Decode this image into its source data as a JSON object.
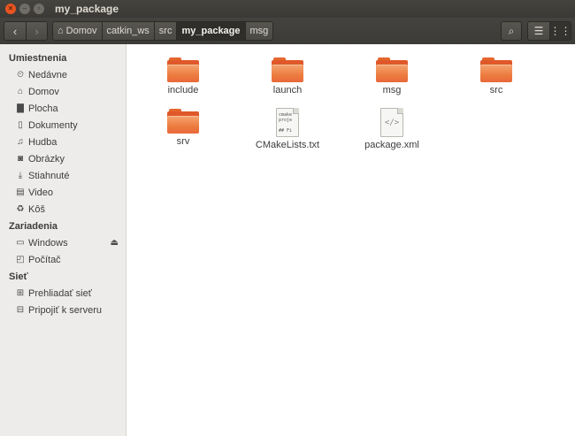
{
  "window": {
    "title": "my_package",
    "close_glyph": "✕",
    "min_glyph": "–",
    "max_glyph": "▫"
  },
  "toolbar": {
    "back_glyph": "‹",
    "forward_glyph": "›",
    "breadcrumbs": [
      "Domov",
      "catkin_ws",
      "src",
      "my_package",
      "msg"
    ],
    "search_glyph": "⌕",
    "list_view_glyph": "☰",
    "grid_view_glyph": "⋮⋮"
  },
  "sidebar": {
    "sections": [
      {
        "title": "Umiestnenia",
        "items": [
          {
            "label": "Nedávne",
            "icon": "clock-icon",
            "glyph": "⏲"
          },
          {
            "label": "Domov",
            "icon": "home-icon",
            "glyph": "⌂"
          },
          {
            "label": "Plocha",
            "icon": "desktop-folder-icon",
            "glyph": "▇"
          },
          {
            "label": "Dokumenty",
            "icon": "document-icon",
            "glyph": "▯"
          },
          {
            "label": "Hudba",
            "icon": "music-icon",
            "glyph": "♫"
          },
          {
            "label": "Obrázky",
            "icon": "camera-icon",
            "glyph": "◙"
          },
          {
            "label": "Stiahnuté",
            "icon": "download-icon",
            "glyph": "⤓"
          },
          {
            "label": "Video",
            "icon": "film-icon",
            "glyph": "▤"
          },
          {
            "label": "Kôš",
            "icon": "trash-icon",
            "glyph": "♻"
          }
        ]
      },
      {
        "title": "Zariadenia",
        "items": [
          {
            "label": "Windows",
            "icon": "drive-icon",
            "glyph": "▭",
            "eject": "⏏"
          },
          {
            "label": "Počítač",
            "icon": "computer-icon",
            "glyph": "◰"
          }
        ]
      },
      {
        "title": "Sieť",
        "items": [
          {
            "label": "Prehliadať sieť",
            "icon": "network-icon",
            "glyph": "⊞"
          },
          {
            "label": "Pripojiť k serveru",
            "icon": "server-icon",
            "glyph": "⊟"
          }
        ]
      }
    ]
  },
  "files": [
    {
      "name": "include",
      "type": "folder"
    },
    {
      "name": "launch",
      "type": "folder"
    },
    {
      "name": "msg",
      "type": "folder"
    },
    {
      "name": "src",
      "type": "folder"
    },
    {
      "name": "srv",
      "type": "folder"
    },
    {
      "name": "CMakeLists.txt",
      "type": "text",
      "preview": "cmake\nproje\n\n## Fi"
    },
    {
      "name": "package.xml",
      "type": "xml",
      "preview": "</>"
    }
  ],
  "colors": {
    "accent": "#e95420",
    "folder": "#ec7a3f",
    "sidebar_bg": "#edecea",
    "toolbar_bg": "#3c3b37"
  }
}
